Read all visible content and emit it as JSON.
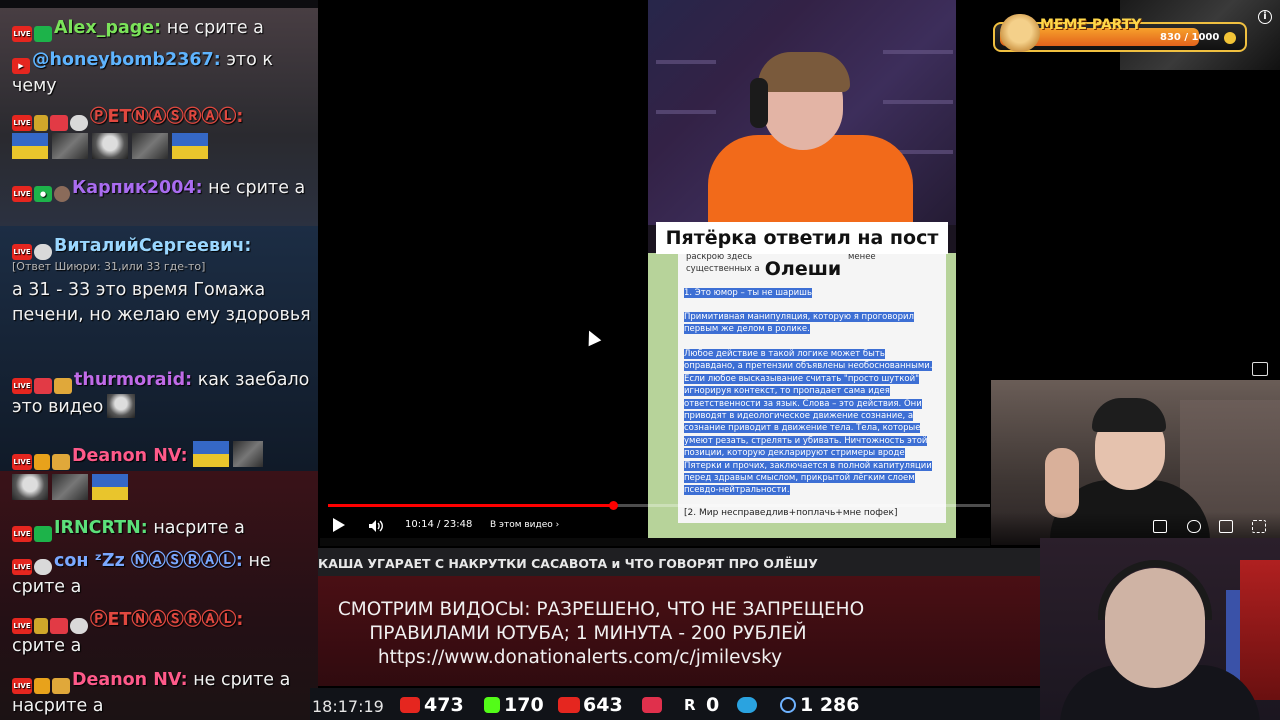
{
  "chat": {
    "messages": [
      {
        "name": "Alex_page:",
        "text": "не срите а",
        "name_color": "#7be35a"
      },
      {
        "name": "@honeybomb2367:",
        "text": "это к чему",
        "name_color": "#5fb4ff"
      },
      {
        "name": "ⓅETⓃⒶⓈⓇⒶⓁ:",
        "text": "",
        "name_color": "#e0483f"
      },
      {
        "name": "Карпик2004:",
        "text": "не срите а",
        "name_color": "#a96cf0"
      },
      {
        "name": "ВиталийСергеевич:",
        "reply": "[Ответ Шиюри: 31,или 33 где-то]",
        "text": "а 31 - 33 это время Гомажа печени, но желаю ему здоровья",
        "name_color": "#9ad7ff"
      },
      {
        "name": "thurmoraid:",
        "text": "как заебало это видео",
        "name_color": "#c06be8"
      },
      {
        "name": "Deanon NV:",
        "text": "",
        "name_color": "#ff5a8a"
      },
      {
        "name": "IRNCRTN:",
        "text": "насрите а",
        "name_color": "#5ce07a"
      },
      {
        "name": "сон ᶻZz ⓃⒶⓈⓇⒶⓁ:",
        "text": "не срите а",
        "name_color": "#7aa8ff"
      },
      {
        "name": "ⓅETⓃⒶⓈⓇⒶⓁ:",
        "text": "срите а",
        "name_color": "#e0483f"
      },
      {
        "name": "Deanon NV:",
        "text": "не срите а насрите а",
        "name_color": "#ff5a8a"
      }
    ]
  },
  "video": {
    "title_line1": "Пятёрка ответил на пост",
    "title_line2": "Олеши",
    "doc_small1": "раскрою здесь",
    "doc_small2": "менее",
    "doc_small3": "существенных а",
    "doc_heading": "1. Это юмор – ты не шаришь",
    "doc_para1": "Примитивная манипуляция, которую я проговорил первым же делом в ролике.",
    "doc_para2": "Любое действие в такой логике может быть оправдано, а претензии объявлены необоснованными. Если любое высказывание считать \"просто шуткой\" игнорируя контекст, то пропадает сама идея ответственности за язык. Слова – это действия. Они приводят в идеологическое движение сознание, а сознание приводит в движение тела. Тела, которые умеют резать, стрелять и убивать. Ничтожность этой позиции, которую декларируют стримеры вроде Пятерки и прочих, заключается в полной капитуляции перед здравым смыслом, прикрытой лёгким слоем псевдо-нейтральности.",
    "doc_next": "[2. Мир несправедлив+поплачь+мне пофек]",
    "time": "10:14 / 23:48",
    "chapter": "В этом видео",
    "progress": 0.43
  },
  "ticker": {
    "text": "КАША УГАРАЕТ С НАКРУТКИ САСАВОТА и ЧТО ГОВОРЯТ ПРО ОЛЁШУ"
  },
  "donate": {
    "line1": "СМОТРИМ ВИДОСЫ: РАЗРЕШЕНО, ЧТО НЕ ЗАПРЕЩЕНО",
    "line2": "ПРАВИЛАМИ ЮТУБА; 1 МИНУТА - 200 РУБЛЕЙ",
    "line3": "https://www.donationalerts.com/c/jmilevsky"
  },
  "stats": {
    "clock": "18:17:19",
    "youtube": "473",
    "kick": "170",
    "vk": "643",
    "rutube": "0",
    "r": "0",
    "telegram": "1 286"
  },
  "meme": {
    "title": "MEME PARTY",
    "value": "830 / 1000",
    "progress": 0.83
  },
  "colors": {
    "accent_red": "#ff0000",
    "youtube_red": "#e5261f",
    "kick_green": "#53fc18",
    "meme_orange": "#f7a12b"
  }
}
